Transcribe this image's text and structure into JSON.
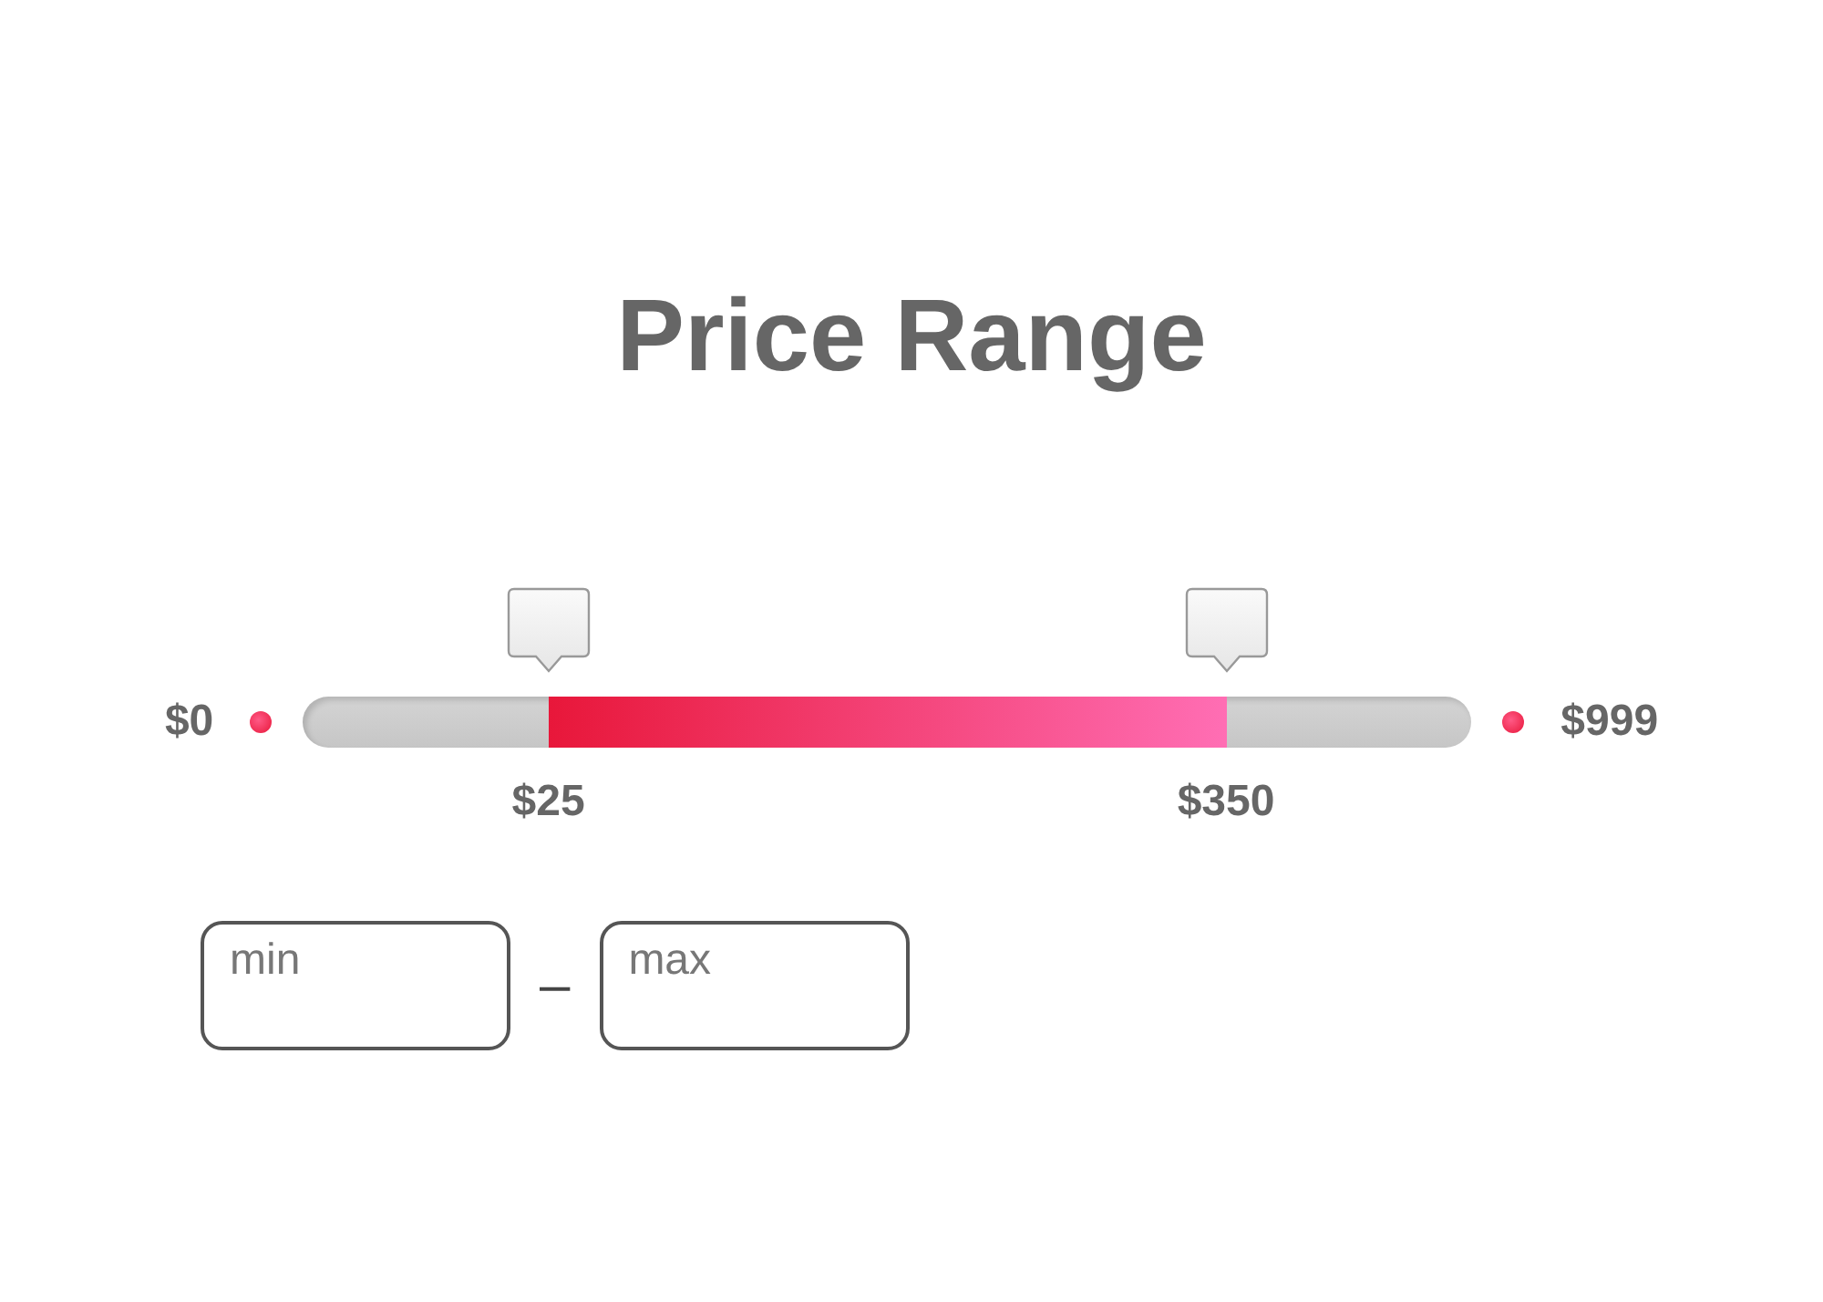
{
  "title": "Price Range",
  "slider": {
    "min_label": "$0",
    "max_label": "$999",
    "low": {
      "level": 0.21,
      "label": "$25"
    },
    "high": {
      "level": 0.79,
      "label": "$350"
    }
  },
  "inputs": [
    {
      "placeholder": "min"
    },
    {
      "placeholder": "max"
    }
  ],
  "separator": "–"
}
